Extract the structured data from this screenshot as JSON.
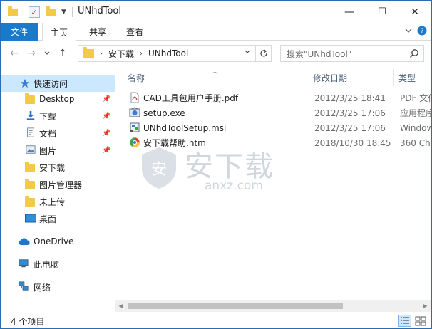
{
  "window": {
    "title": "UNhdTool",
    "controls": {
      "minimize": "—",
      "maximize": "☐",
      "close": "✕"
    }
  },
  "ribbon": {
    "tabs": [
      {
        "label": "文件"
      },
      {
        "label": "主页"
      },
      {
        "label": "共享"
      },
      {
        "label": "查看"
      }
    ],
    "expand_icon": "chevron-down-icon",
    "help_icon": "help-icon"
  },
  "nav": {
    "back": "←",
    "forward": "→",
    "recent": "⌄",
    "up": "↑",
    "breadcrumb": [
      "安下载",
      "UNhdTool"
    ],
    "search_placeholder": "搜索\"UNhdTool\""
  },
  "sidebar": {
    "items": [
      {
        "label": "快速访问",
        "icon": "star-icon"
      },
      {
        "label": "Desktop",
        "icon": "folder-icon",
        "pinned": true
      },
      {
        "label": "下载",
        "icon": "download-icon",
        "pinned": true
      },
      {
        "label": "文档",
        "icon": "document-icon",
        "pinned": true
      },
      {
        "label": "图片",
        "icon": "picture-icon",
        "pinned": true
      },
      {
        "label": "安下载",
        "icon": "folder-icon"
      },
      {
        "label": "图片管理器",
        "icon": "folder-icon"
      },
      {
        "label": "未上传",
        "icon": "folder-icon"
      },
      {
        "label": "桌面",
        "icon": "desktop-icon"
      },
      {
        "label": "OneDrive",
        "icon": "cloud-icon"
      },
      {
        "label": "此电脑",
        "icon": "computer-icon"
      },
      {
        "label": "网络",
        "icon": "network-icon"
      }
    ]
  },
  "list": {
    "columns": {
      "name": "名称",
      "date": "修改日期",
      "type": "类型"
    },
    "files": [
      {
        "name": "CAD工具包用户手册.pdf",
        "date": "2012/3/25 18:41",
        "type": "PDF 文件",
        "icon": "pdf-icon"
      },
      {
        "name": "setup.exe",
        "date": "2012/3/25 17:06",
        "type": "应用程序",
        "icon": "installer-icon"
      },
      {
        "name": "UNhdToolSetup.msi",
        "date": "2012/3/25 17:06",
        "type": "Windows",
        "icon": "msi-icon"
      },
      {
        "name": "安下载帮助.htm",
        "date": "2018/10/30 18:45",
        "type": "360 Chr",
        "icon": "browser-icon"
      }
    ]
  },
  "watermark": {
    "text": "安下载",
    "sub": "anxz.com"
  },
  "status": {
    "count": "4 个项目"
  },
  "colors": {
    "accent": "#1979ca",
    "selection": "#cce8ff",
    "folder": "#f3c94a"
  }
}
